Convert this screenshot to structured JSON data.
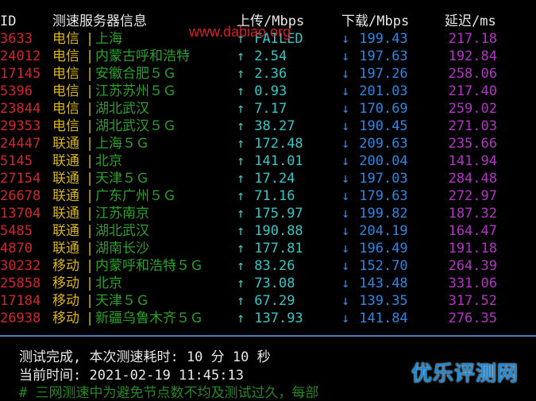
{
  "header": {
    "id": "ID",
    "server": "测速服务器信息",
    "upload": "上传/Mbps",
    "download": "下载/Mbps",
    "latency": "延迟/ms"
  },
  "arrows": {
    "up": "↑",
    "down": "↓"
  },
  "separator": "|",
  "rows": [
    {
      "id": "3633",
      "isp": "电信",
      "node": "上海",
      "up": "FAILED",
      "down": "199.43",
      "lat": "217.18"
    },
    {
      "id": "24012",
      "isp": "电信",
      "node": "内蒙古呼和浩特",
      "up": "2.54",
      "down": "197.63",
      "lat": "192.84"
    },
    {
      "id": "17145",
      "isp": "电信",
      "node": "安徽合肥５Ｇ",
      "up": "2.36",
      "down": "197.26",
      "lat": "258.06"
    },
    {
      "id": "5396",
      "isp": "电信",
      "node": "江苏苏州５Ｇ",
      "up": "0.93",
      "down": "201.03",
      "lat": "217.40"
    },
    {
      "id": "23844",
      "isp": "电信",
      "node": "湖北武汉",
      "up": "7.17",
      "down": "170.69",
      "lat": "259.02"
    },
    {
      "id": "29353",
      "isp": "电信",
      "node": "湖北武汉５Ｇ",
      "up": "38.27",
      "down": "190.45",
      "lat": "271.03"
    },
    {
      "id": "24447",
      "isp": "联通",
      "node": "上海５Ｇ",
      "up": "172.48",
      "down": "209.63",
      "lat": "235.66"
    },
    {
      "id": "5145",
      "isp": "联通",
      "node": "北京",
      "up": "141.01",
      "down": "200.04",
      "lat": "141.94"
    },
    {
      "id": "27154",
      "isp": "联通",
      "node": "天津５Ｇ",
      "up": "17.24",
      "down": "197.03",
      "lat": "284.48"
    },
    {
      "id": "26678",
      "isp": "联通",
      "node": "广东广州５Ｇ",
      "up": "71.16",
      "down": "179.63",
      "lat": "272.97"
    },
    {
      "id": "13704",
      "isp": "联通",
      "node": "江苏南京",
      "up": "175.97",
      "down": "199.82",
      "lat": "187.32"
    },
    {
      "id": "5485",
      "isp": "联通",
      "node": "湖北武汉",
      "up": "190.88",
      "down": "204.19",
      "lat": "164.47"
    },
    {
      "id": "4870",
      "isp": "联通",
      "node": "湖南长沙",
      "up": "177.81",
      "down": "196.49",
      "lat": "191.18"
    },
    {
      "id": "30232",
      "isp": "移动",
      "node": "内蒙呼和浩特５Ｇ",
      "up": "83.26",
      "down": "152.70",
      "lat": "264.39"
    },
    {
      "id": "25858",
      "isp": "移动",
      "node": "北京",
      "up": "73.08",
      "down": "143.48",
      "lat": "331.06"
    },
    {
      "id": "17184",
      "isp": "移动",
      "node": "天津５Ｇ",
      "up": "67.29",
      "down": "139.35",
      "lat": "317.52"
    },
    {
      "id": "26938",
      "isp": "移动",
      "node": "新疆乌鲁木齐５Ｇ",
      "up": "137.93",
      "down": "141.84",
      "lat": "276.35"
    }
  ],
  "footer": {
    "complete": "测试完成, 本次测速耗时: 10 分 10 秒",
    "time": "当前时间: 2021-02-19 11:45:13",
    "note": "# 三网测速中为避免节点数不均及测试过久，每部"
  },
  "watermarks": {
    "url": "www.dabiao.org",
    "logo": "优乐评测网"
  },
  "colors": {
    "background": "#000000",
    "id": "#d1262b",
    "isp": "#d9b418",
    "node": "#2ca02c",
    "upload": "#35c7c7",
    "download": "#2f86e0",
    "latency": "#b533c6"
  }
}
